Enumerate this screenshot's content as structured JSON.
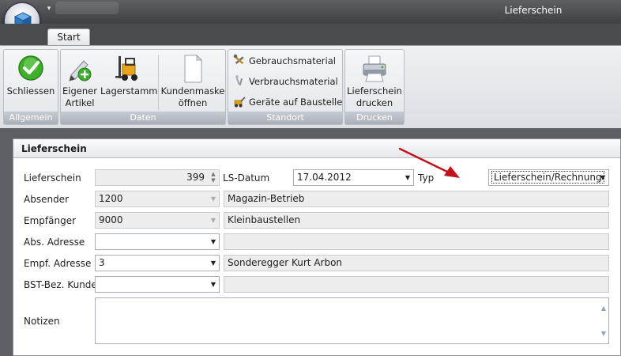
{
  "window": {
    "title": "Lieferschein"
  },
  "tabs": [
    {
      "label": "Start"
    }
  ],
  "ribbon": {
    "groups": [
      {
        "label": "Allgemein",
        "buttons": [
          {
            "label": "Schliessen"
          }
        ]
      },
      {
        "label": "Daten",
        "buttons": [
          {
            "label_line1": "Eigener",
            "label_line2": "Artikel"
          },
          {
            "label": "Lagerstamm"
          },
          {
            "label_line1": "Kundenmaske",
            "label_line2": "öffnen"
          }
        ]
      },
      {
        "label": "Standort",
        "buttons": [
          {
            "label": "Gebrauchsmaterial"
          },
          {
            "label": "Verbrauchsmaterial"
          },
          {
            "label": "Geräte auf Baustelle"
          }
        ]
      },
      {
        "label": "Drucken",
        "buttons": [
          {
            "label_line1": "Lieferschein",
            "label_line2": "drucken"
          }
        ]
      }
    ]
  },
  "panel": {
    "title": "Lieferschein",
    "form": {
      "lieferschein": {
        "label": "Lieferschein",
        "value": "399"
      },
      "ls_datum": {
        "label": "LS-Datum",
        "value": "17.04.2012"
      },
      "typ": {
        "label": "Typ",
        "value": "Lieferschein/Rechnung"
      },
      "absender": {
        "label": "Absender",
        "value": "1200",
        "name": "Magazin-Betrieb"
      },
      "empfaenger": {
        "label": "Empfänger",
        "value": "9000",
        "name": "Kleinbaustellen"
      },
      "abs_adresse": {
        "label": "Abs. Adresse",
        "value": "",
        "name": ""
      },
      "empf_adresse": {
        "label": "Empf. Adresse",
        "value": "3",
        "name": "Sonderegger Kurt Arbon"
      },
      "bst_bez_kunde": {
        "label": "BST-Bez. Kunde",
        "value": "",
        "name": ""
      },
      "notizen": {
        "label": "Notizen",
        "value": ""
      }
    }
  },
  "colors": {
    "annotation_arrow": "#c0141c",
    "titlebar": "#4a4b4f",
    "ribbon": "#e3e6ea"
  },
  "icons": {
    "app_orb": "cube-stack-icon",
    "schliessen": "green-check-icon",
    "eigener_artikel": "pencil-plus-icon",
    "lagerstamm": "forklift-icon",
    "kundenmaske": "document-icon",
    "gebrauchsmaterial": "tools-icon",
    "verbrauchsmaterial": "screws-icon",
    "geraete": "construction-machine-icon",
    "drucken": "printer-icon"
  }
}
